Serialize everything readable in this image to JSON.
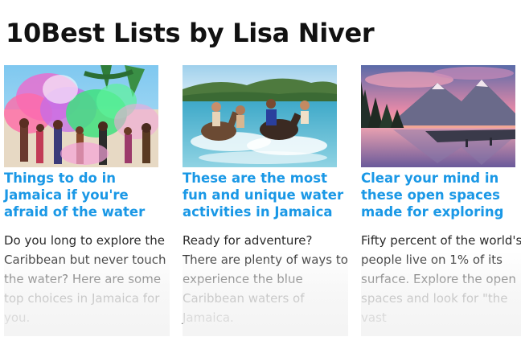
{
  "page": {
    "title": "10Best Lists by Lisa Niver"
  },
  "theme": {
    "headline_color": "#1a98e6",
    "text_color": "#2b2b2b"
  },
  "cards": [
    {
      "image": "jamaica-color-run-photo",
      "headline": "Things to do in Jamaica if you're afraid of the water",
      "blurb": "Do you long to explore the Caribbean but never touch the water? Here are some top choices in Jamaica for you."
    },
    {
      "image": "horseback-swimming-photo",
      "headline": "These are the most fun and unique water activities in Jamaica",
      "blurb": "Ready for adventure? There are plenty of ways to experience the blue Caribbean waters of Jamaica."
    },
    {
      "image": "mountain-lake-sunset-photo",
      "headline": "Clear your mind in these open spaces made for exploring",
      "blurb": "Fifty percent of the world's people live on 1% of its surface. Explore the open spaces and look for \"the vast"
    }
  ]
}
